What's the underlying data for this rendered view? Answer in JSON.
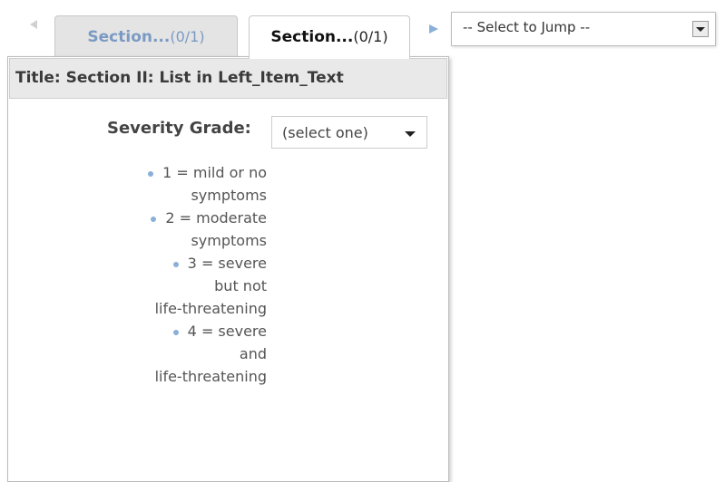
{
  "nav": {
    "prev_icon": "triangle-left-icon",
    "next_icon": "triangle-right-icon"
  },
  "tabs": [
    {
      "name": "Section...",
      "count": "(0/1)",
      "active": false
    },
    {
      "name": "Section...",
      "count": "(0/1)",
      "active": true
    }
  ],
  "jump": {
    "selected": "-- Select to Jump --",
    "dropdown_icon": "chevron-down-icon"
  },
  "panel": {
    "title": "Title: Section II: List in Left_Item_Text",
    "severity_label": "Severity Grade:",
    "severity_value": "(select one)",
    "grades": [
      {
        "lines": [
          "1 = mild or no",
          "symptoms"
        ]
      },
      {
        "lines": [
          "2 = moderate",
          "symptoms"
        ]
      },
      {
        "lines": [
          "3 = severe",
          "but not",
          "life-threatening"
        ]
      },
      {
        "lines": [
          "4 = severe",
          "and",
          "life-threatening"
        ]
      }
    ]
  },
  "colors": {
    "accent": "#8ab0d8",
    "inactive_tab_text": "#7a9ac4"
  }
}
